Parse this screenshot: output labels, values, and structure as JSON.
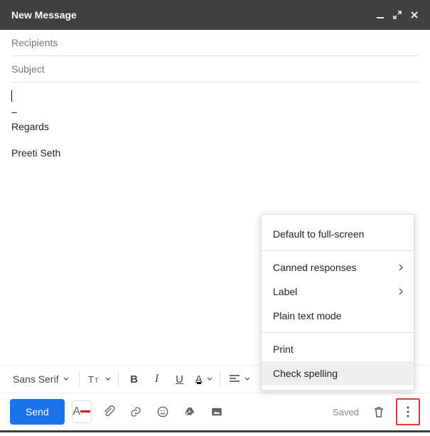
{
  "header": {
    "title": "New Message"
  },
  "fields": {
    "recipients_placeholder": "Recipients",
    "subject_placeholder": "Subject"
  },
  "body": {
    "signature_separator": "--",
    "signature_lines": [
      "Regards",
      "Preeti Seth"
    ]
  },
  "toolbar": {
    "font_family": "Sans Serif",
    "bold": "B",
    "italic": "I",
    "underline": "U",
    "color_A": "A"
  },
  "actions": {
    "send": "Send",
    "format_A": "A",
    "saved": "Saved"
  },
  "menu": {
    "items": [
      {
        "label": "Default to full-screen"
      },
      {
        "label": "Canned responses",
        "submenu": true
      },
      {
        "label": "Label",
        "submenu": true
      },
      {
        "label": "Plain text mode"
      },
      {
        "label": "Print"
      },
      {
        "label": "Check spelling",
        "selected": true
      }
    ]
  }
}
